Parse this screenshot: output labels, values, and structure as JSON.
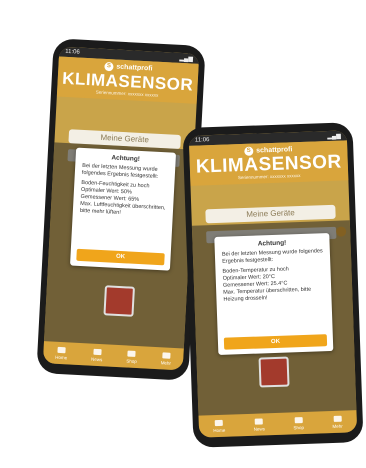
{
  "phones": [
    {
      "time": "11:06",
      "brand": "schattprofi",
      "title": "KLIMASENSOR",
      "subtitle": "Seriennummer: xxxxxxx  xxxxxx",
      "devices_button": "Meine Geräte",
      "dialog": {
        "title": "Achtung!",
        "intro": "Bei der letzten Messung wurde folgendes Ergebnis festgestellt:",
        "details": "Boden-Feuchtigkeit zu hoch\nOptimaler Wert: 50%\nGemessener Wert: 65%\nMax. Luftfeuchtigkeit überschritten, bitte mehr lüften!",
        "ok": "OK"
      },
      "nav": [
        "Home",
        "News",
        "Shop",
        "Mehr"
      ]
    },
    {
      "time": "11:06",
      "brand": "schattprofi",
      "title": "KLIMASENSOR",
      "subtitle": "Seriennummer: xxxxxxx  xxxxxx",
      "devices_button": "Meine Geräte",
      "dialog": {
        "title": "Achtung!",
        "intro": "Bei der letzten Messung wurde folgendes Ergebnis festgestellt:",
        "details": "Boden-Temperatur zu hoch\nOptimaler Wert: 20°C\nGemessener Wert: 25.4°C\nMax. Temperatur überschritten, bitte Heizung drosseln!",
        "ok": "OK"
      },
      "nav": [
        "Home",
        "News",
        "Shop",
        "Mehr"
      ]
    }
  ]
}
